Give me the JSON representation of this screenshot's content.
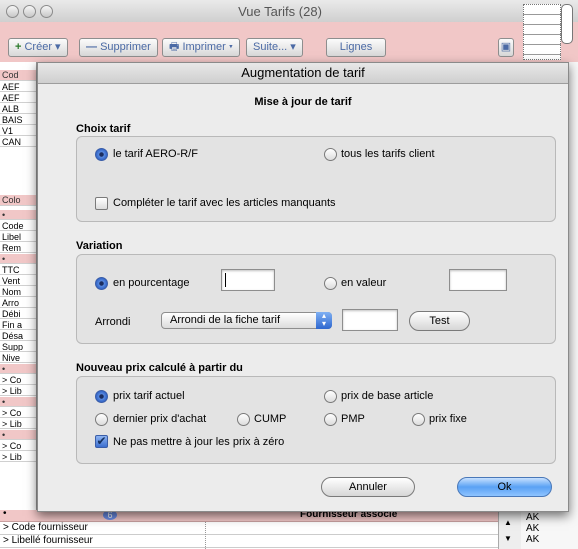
{
  "window": {
    "title": "Vue Tarifs  (28)"
  },
  "toolbar": {
    "create": "Créer",
    "delete": "Supprimer",
    "print": "Imprimer",
    "more": "Suite...",
    "lines": "Lignes"
  },
  "back_list": {
    "header": "Cod",
    "rows": [
      "AEF",
      "AEF",
      "ALB",
      "BAIS",
      "V1",
      "CAN"
    ],
    "header2": "Colo",
    "rows2": [
      "•",
      "Code",
      "Libel",
      "Rem",
      "•",
      "TTC",
      "Vent",
      "Nom",
      "Arro",
      "Débi",
      "Fin a",
      "Désa",
      "Supp",
      "Nive",
      "•",
      "> Co",
      "> Lib",
      "•",
      "> Co",
      "> Lib",
      "•",
      "> Co",
      "> Lib"
    ]
  },
  "bottom_rows": {
    "fournisseur_associe": "Fournisseur associé",
    "code_fournisseur": "> Code fournisseur",
    "libelle_fournisseur": "> Libellé fournisseur",
    "badge": "6",
    "right_col": [
      "AK",
      "AK",
      "AK"
    ]
  },
  "dialog": {
    "title": "Augmentation de tarif",
    "subtitle": "Mise à jour de tarif",
    "choix": {
      "label": "Choix tarif",
      "option1": "le tarif AERO-R/F",
      "option2": "tous les tarifs client",
      "complete_label": "Compléter le tarif avec les articles manquants",
      "selected": "option1",
      "complete_checked": false
    },
    "variation": {
      "label": "Variation",
      "percent_label": "en pourcentage",
      "percent_value": "",
      "value_label": "en valeur",
      "value_value": "",
      "selected": "percent",
      "rounding_label": "Arrondi",
      "rounding_option": "Arrondi de la fiche tarif",
      "rounding_value": "",
      "test_button": "Test"
    },
    "nouveau": {
      "label": "Nouveau prix calculé à partir du",
      "options": [
        "prix tarif actuel",
        "prix de base article",
        "dernier prix d'achat",
        "CUMP",
        "PMP",
        "prix fixe"
      ],
      "selected": "prix tarif actuel",
      "zero_label": "Ne pas mettre à jour les prix à zéro",
      "zero_checked": true
    },
    "cancel_button": "Annuler",
    "ok_button": "Ok"
  },
  "colors": {
    "toolbar_pink": "#f1c7c7",
    "default_button": "#5aa1f4"
  }
}
